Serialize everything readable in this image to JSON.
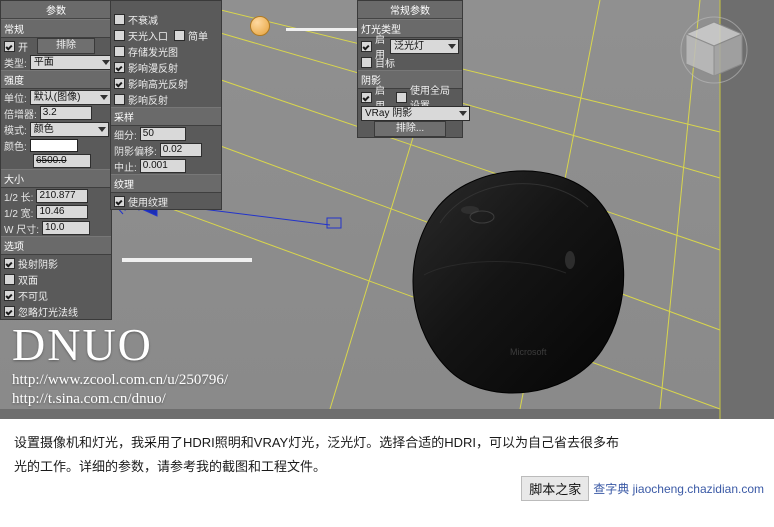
{
  "app": {
    "viewport_bg": "#8c8c8c",
    "grid_color": "#d8d54a"
  },
  "params_panel": {
    "title": "参数",
    "sections": {
      "general": "常规",
      "size": "大小",
      "options": "选项"
    },
    "on_label": "开",
    "exclude_button": "排除",
    "type_label": "类型:",
    "type_value": "平面",
    "intensity_title": "强度",
    "unit_label": "单位:",
    "unit_value": "默认(图像)",
    "multiplier_label": "倍增器:",
    "multiplier_value": "3.2",
    "mode_label": "模式:",
    "mode_value": "颜色",
    "color_label": "颜色:",
    "color_swatch": "#ffffff",
    "temp_label": "",
    "temp_value": "6500.0",
    "size_half_len_label": "1/2 长:",
    "size_half_len_value": "210.877",
    "size_half_wid_label": "1/2 宽:",
    "size_half_wid_value": "10.46",
    "size_w_label": "W 尺寸:",
    "size_w_value": "10.0",
    "opt_cast_shadows": "投射阴影",
    "opt_double_sided": "双面",
    "opt_invisible": "不可见",
    "opt_ignore_normals": "忽略灯光法线"
  },
  "mid_panel": {
    "opt_no_decay": "不衰减",
    "opt_skylight_portal": "天光入口",
    "opt_simple": "简单",
    "opt_store_irradiance": "存储发光图",
    "opt_affect_diffuse": "影响漫反射",
    "opt_affect_specular": "影响高光反射",
    "opt_affect_reflection": "影响反射",
    "sampling_title": "采样",
    "subdivs_label": "细分:",
    "subdivs_value": "50",
    "shadow_bias_label": "阴影偏移:",
    "shadow_bias_value": "0.02",
    "cutoff_label": "中止:",
    "cutoff_value": "0.001",
    "texture_title": "纹理",
    "use_texture": "使用纹理"
  },
  "vray_panel": {
    "title": "常规参数",
    "light_type_title": "灯光类型",
    "enable_label": "启用",
    "light_type_value": "泛光灯",
    "target_label": "目标",
    "shadow_title": "阴影",
    "shadow_enable_label": "启用",
    "use_global_settings_label": "使用全局设置",
    "shadow_type_value": "VRay 阴影",
    "exclude_button": "排除..."
  },
  "watermark": {
    "brand": "DNUO",
    "line1": "http://www.zcool.com.cn/u/250796/",
    "line2": "http://t.sina.com.cn/dnuo/"
  },
  "caption": {
    "line1": "设置摄像机和灯光，我采用了HDRI照明和VRAY灯光，泛光灯。选择合适的HDRI，可以为自己省去很多布",
    "line2": "光的工作。详细的参数，请参考我的截图和工程文件。"
  },
  "footer_logos": {
    "left": "脚本之家",
    "right": "查字典  jiaocheng.chazidian.com",
    "site": "jiaocheng.chazidian.com"
  }
}
